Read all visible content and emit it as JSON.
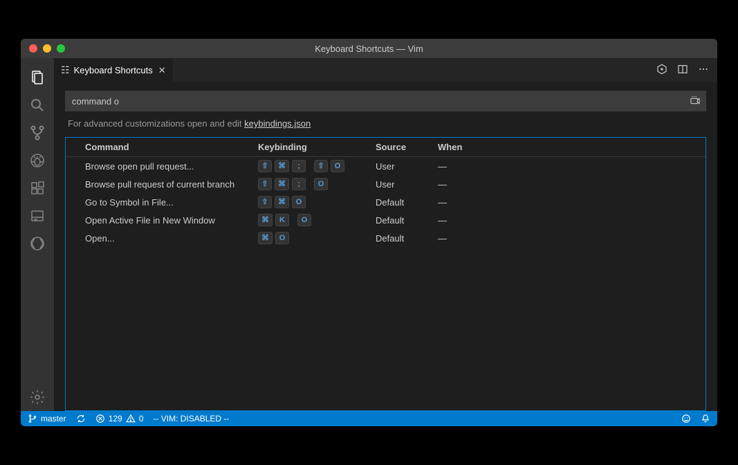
{
  "window": {
    "title": "Keyboard Shortcuts — Vim"
  },
  "tab": {
    "label": "Keyboard Shortcuts"
  },
  "search": {
    "value": "command o"
  },
  "hint": {
    "prefix": "For advanced customizations open and edit ",
    "link": "keybindings.json"
  },
  "columns": {
    "command": "Command",
    "keybinding": "Keybinding",
    "source": "Source",
    "when": "When"
  },
  "rows": [
    {
      "command": "Browse open pull request...",
      "keys": [
        "⇧",
        "⌘",
        ";",
        "␣",
        "⇧",
        "O"
      ],
      "source": "User",
      "when": "—"
    },
    {
      "command": "Browse pull request of current branch",
      "keys": [
        "⇧",
        "⌘",
        ";",
        "␣",
        "O"
      ],
      "source": "User",
      "when": "—"
    },
    {
      "command": "Go to Symbol in File...",
      "keys": [
        "⇧",
        "⌘",
        "O"
      ],
      "source": "Default",
      "when": "—"
    },
    {
      "command": "Open Active File in New Window",
      "keys": [
        "⌘",
        "K",
        "␣",
        "O"
      ],
      "source": "Default",
      "when": "—"
    },
    {
      "command": "Open...",
      "keys": [
        "⌘",
        "O"
      ],
      "source": "Default",
      "when": "—"
    }
  ],
  "status": {
    "branch": "master",
    "errors": "129",
    "warnings": "0",
    "vim": "-- VIM: DISABLED --"
  }
}
